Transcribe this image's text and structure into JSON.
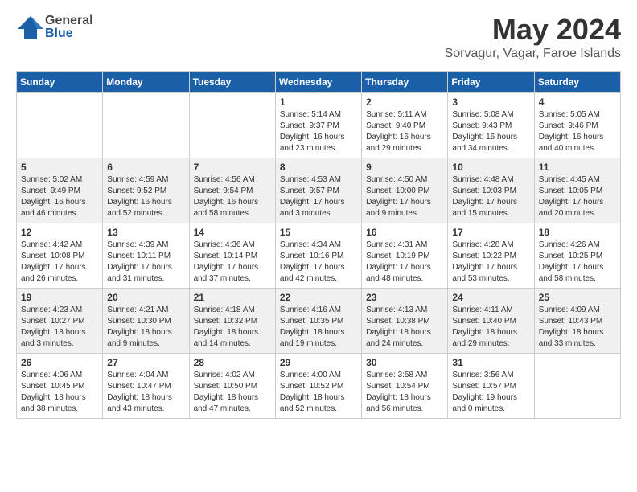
{
  "header": {
    "logo_general": "General",
    "logo_blue": "Blue",
    "month_year": "May 2024",
    "location": "Sorvagur, Vagar, Faroe Islands"
  },
  "weekdays": [
    "Sunday",
    "Monday",
    "Tuesday",
    "Wednesday",
    "Thursday",
    "Friday",
    "Saturday"
  ],
  "rows": [
    {
      "shade": "white",
      "cells": [
        {
          "day": "",
          "info": ""
        },
        {
          "day": "",
          "info": ""
        },
        {
          "day": "",
          "info": ""
        },
        {
          "day": "1",
          "info": "Sunrise: 5:14 AM\nSunset: 9:37 PM\nDaylight: 16 hours\nand 23 minutes."
        },
        {
          "day": "2",
          "info": "Sunrise: 5:11 AM\nSunset: 9:40 PM\nDaylight: 16 hours\nand 29 minutes."
        },
        {
          "day": "3",
          "info": "Sunrise: 5:08 AM\nSunset: 9:43 PM\nDaylight: 16 hours\nand 34 minutes."
        },
        {
          "day": "4",
          "info": "Sunrise: 5:05 AM\nSunset: 9:46 PM\nDaylight: 16 hours\nand 40 minutes."
        }
      ]
    },
    {
      "shade": "shaded",
      "cells": [
        {
          "day": "5",
          "info": "Sunrise: 5:02 AM\nSunset: 9:49 PM\nDaylight: 16 hours\nand 46 minutes."
        },
        {
          "day": "6",
          "info": "Sunrise: 4:59 AM\nSunset: 9:52 PM\nDaylight: 16 hours\nand 52 minutes."
        },
        {
          "day": "7",
          "info": "Sunrise: 4:56 AM\nSunset: 9:54 PM\nDaylight: 16 hours\nand 58 minutes."
        },
        {
          "day": "8",
          "info": "Sunrise: 4:53 AM\nSunset: 9:57 PM\nDaylight: 17 hours\nand 3 minutes."
        },
        {
          "day": "9",
          "info": "Sunrise: 4:50 AM\nSunset: 10:00 PM\nDaylight: 17 hours\nand 9 minutes."
        },
        {
          "day": "10",
          "info": "Sunrise: 4:48 AM\nSunset: 10:03 PM\nDaylight: 17 hours\nand 15 minutes."
        },
        {
          "day": "11",
          "info": "Sunrise: 4:45 AM\nSunset: 10:05 PM\nDaylight: 17 hours\nand 20 minutes."
        }
      ]
    },
    {
      "shade": "white",
      "cells": [
        {
          "day": "12",
          "info": "Sunrise: 4:42 AM\nSunset: 10:08 PM\nDaylight: 17 hours\nand 26 minutes."
        },
        {
          "day": "13",
          "info": "Sunrise: 4:39 AM\nSunset: 10:11 PM\nDaylight: 17 hours\nand 31 minutes."
        },
        {
          "day": "14",
          "info": "Sunrise: 4:36 AM\nSunset: 10:14 PM\nDaylight: 17 hours\nand 37 minutes."
        },
        {
          "day": "15",
          "info": "Sunrise: 4:34 AM\nSunset: 10:16 PM\nDaylight: 17 hours\nand 42 minutes."
        },
        {
          "day": "16",
          "info": "Sunrise: 4:31 AM\nSunset: 10:19 PM\nDaylight: 17 hours\nand 48 minutes."
        },
        {
          "day": "17",
          "info": "Sunrise: 4:28 AM\nSunset: 10:22 PM\nDaylight: 17 hours\nand 53 minutes."
        },
        {
          "day": "18",
          "info": "Sunrise: 4:26 AM\nSunset: 10:25 PM\nDaylight: 17 hours\nand 58 minutes."
        }
      ]
    },
    {
      "shade": "shaded",
      "cells": [
        {
          "day": "19",
          "info": "Sunrise: 4:23 AM\nSunset: 10:27 PM\nDaylight: 18 hours\nand 3 minutes."
        },
        {
          "day": "20",
          "info": "Sunrise: 4:21 AM\nSunset: 10:30 PM\nDaylight: 18 hours\nand 9 minutes."
        },
        {
          "day": "21",
          "info": "Sunrise: 4:18 AM\nSunset: 10:32 PM\nDaylight: 18 hours\nand 14 minutes."
        },
        {
          "day": "22",
          "info": "Sunrise: 4:16 AM\nSunset: 10:35 PM\nDaylight: 18 hours\nand 19 minutes."
        },
        {
          "day": "23",
          "info": "Sunrise: 4:13 AM\nSunset: 10:38 PM\nDaylight: 18 hours\nand 24 minutes."
        },
        {
          "day": "24",
          "info": "Sunrise: 4:11 AM\nSunset: 10:40 PM\nDaylight: 18 hours\nand 29 minutes."
        },
        {
          "day": "25",
          "info": "Sunrise: 4:09 AM\nSunset: 10:43 PM\nDaylight: 18 hours\nand 33 minutes."
        }
      ]
    },
    {
      "shade": "white",
      "cells": [
        {
          "day": "26",
          "info": "Sunrise: 4:06 AM\nSunset: 10:45 PM\nDaylight: 18 hours\nand 38 minutes."
        },
        {
          "day": "27",
          "info": "Sunrise: 4:04 AM\nSunset: 10:47 PM\nDaylight: 18 hours\nand 43 minutes."
        },
        {
          "day": "28",
          "info": "Sunrise: 4:02 AM\nSunset: 10:50 PM\nDaylight: 18 hours\nand 47 minutes."
        },
        {
          "day": "29",
          "info": "Sunrise: 4:00 AM\nSunset: 10:52 PM\nDaylight: 18 hours\nand 52 minutes."
        },
        {
          "day": "30",
          "info": "Sunrise: 3:58 AM\nSunset: 10:54 PM\nDaylight: 18 hours\nand 56 minutes."
        },
        {
          "day": "31",
          "info": "Sunrise: 3:56 AM\nSunset: 10:57 PM\nDaylight: 19 hours\nand 0 minutes."
        },
        {
          "day": "",
          "info": ""
        }
      ]
    }
  ]
}
